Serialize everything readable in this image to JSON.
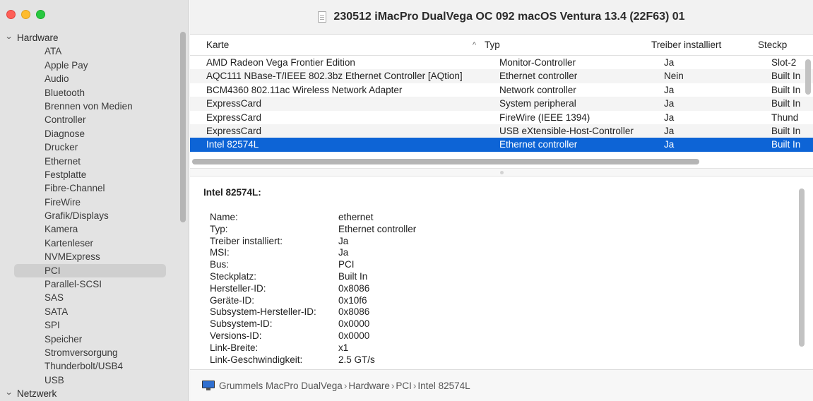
{
  "window": {
    "title": "230512 iMacPro DualVega OC 092 macOS Ventura 13.4 (22F63) 01"
  },
  "sidebar": {
    "groups": [
      {
        "label": "Hardware"
      },
      {
        "label": "Netzwerk"
      }
    ],
    "items": [
      "ATA",
      "Apple Pay",
      "Audio",
      "Bluetooth",
      "Brennen von Medien",
      "Controller",
      "Diagnose",
      "Drucker",
      "Ethernet",
      "Festplatte",
      "Fibre-Channel",
      "FireWire",
      "Grafik/Displays",
      "Kamera",
      "Kartenleser",
      "NVMExpress",
      "PCI",
      "Parallel-SCSI",
      "SAS",
      "SATA",
      "SPI",
      "Speicher",
      "Stromversorgung",
      "Thunderbolt/USB4",
      "USB"
    ],
    "selected": "PCI"
  },
  "table": {
    "headers": [
      "Karte",
      "Typ",
      "Treiber installiert",
      "Steckp"
    ],
    "sort_indicator": "^",
    "rows": [
      [
        "AMD Radeon Vega Frontier Edition",
        "Monitor-Controller",
        "Ja",
        "Slot-2"
      ],
      [
        "AQC111 NBase-T/IEEE 802.3bz Ethernet Controller [AQtion]",
        "Ethernet controller",
        "Nein",
        "Built In"
      ],
      [
        "BCM4360 802.11ac Wireless Network Adapter",
        "Network controller",
        "Ja",
        "Built In"
      ],
      [
        "ExpressCard",
        "System peripheral",
        "Ja",
        "Built In"
      ],
      [
        "ExpressCard",
        "FireWire (IEEE 1394)",
        "Ja",
        "Thund"
      ],
      [
        "ExpressCard",
        "USB eXtensible-Host-Controller",
        "Ja",
        "Built In"
      ],
      [
        "Intel 82574L",
        "Ethernet controller",
        "Ja",
        "Built In"
      ]
    ],
    "selected_row": 6
  },
  "detail": {
    "title": "Intel 82574L:",
    "fields": [
      [
        "Name:",
        "ethernet"
      ],
      [
        "Typ:",
        "Ethernet controller"
      ],
      [
        "Treiber installiert:",
        "Ja"
      ],
      [
        "MSI:",
        "Ja"
      ],
      [
        "Bus:",
        "PCI"
      ],
      [
        "Steckplatz:",
        "Built In"
      ],
      [
        "Hersteller-ID:",
        "0x8086"
      ],
      [
        "Geräte-ID:",
        "0x10f6"
      ],
      [
        "Subsystem-Hersteller-ID:",
        "0x8086"
      ],
      [
        "Subsystem-ID:",
        "0x0000"
      ],
      [
        "Versions-ID:",
        "0x0000"
      ],
      [
        "Link-Breite:",
        "x1"
      ],
      [
        "Link-Geschwindigkeit:",
        "2.5 GT/s"
      ]
    ]
  },
  "pathbar": {
    "crumbs": [
      "Grummels MacPro DualVega",
      "Hardware",
      "PCI",
      "Intel 82574L"
    ],
    "separator": "›"
  },
  "colors": {
    "selection": "#0d64d6",
    "sidebar_bg": "#e3e3e3",
    "close": "#fe5f57",
    "minimize": "#febc2e",
    "maximize": "#28c840"
  }
}
